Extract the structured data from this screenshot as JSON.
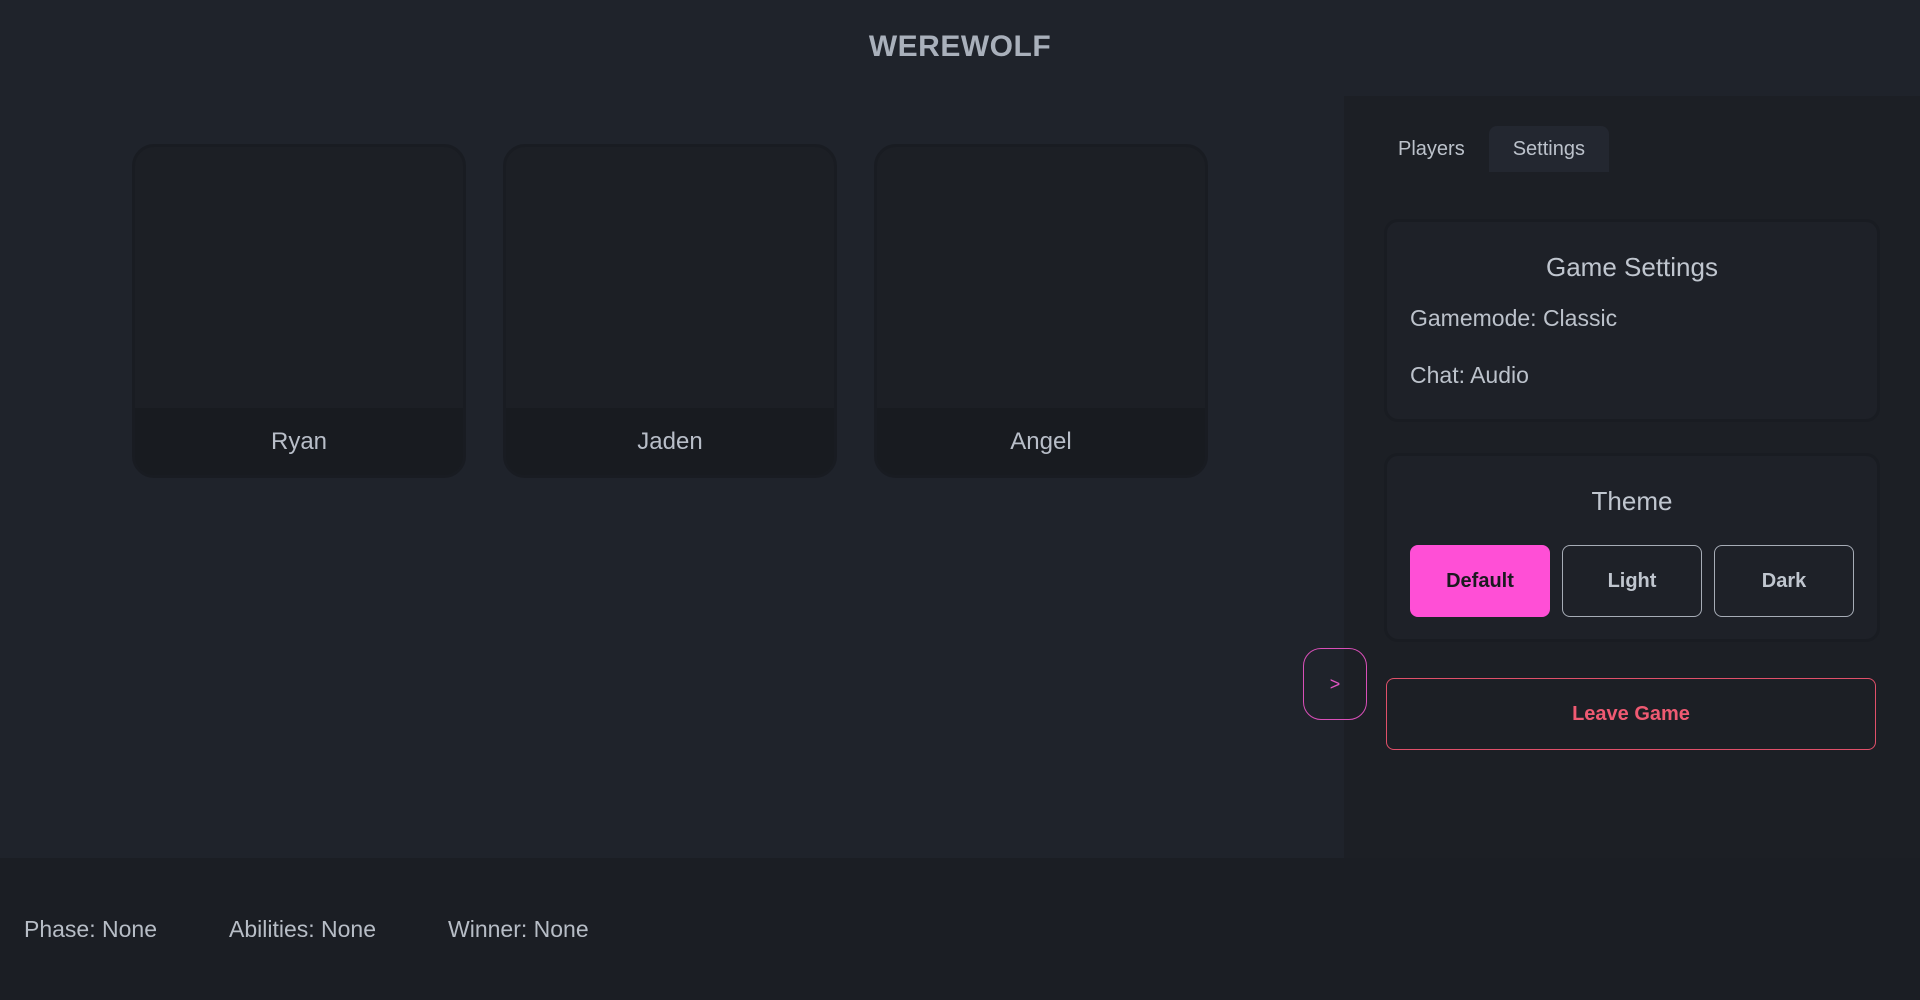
{
  "app": {
    "title": "WEREWOLF"
  },
  "players": [
    {
      "name": "Ryan"
    },
    {
      "name": "Jaden"
    },
    {
      "name": "Angel"
    }
  ],
  "collapse_button": {
    "label": ">"
  },
  "side_panel": {
    "tabs": [
      {
        "label": "Players",
        "active": false
      },
      {
        "label": "Settings",
        "active": true
      }
    ],
    "game_settings": {
      "title": "Game Settings",
      "gamemode": "Gamemode: Classic",
      "chat": "Chat: Audio"
    },
    "theme": {
      "title": "Theme",
      "options": [
        {
          "label": "Default",
          "selected": true
        },
        {
          "label": "Light",
          "selected": false
        },
        {
          "label": "Dark",
          "selected": false
        }
      ]
    },
    "leave_label": "Leave Game"
  },
  "status": {
    "phase": "Phase: None",
    "abilities": "Abilities: None",
    "winner": "Winner: None"
  },
  "colors": {
    "accent": "#ff4fd6",
    "danger": "#ef5a72",
    "background": "#1f232b"
  }
}
